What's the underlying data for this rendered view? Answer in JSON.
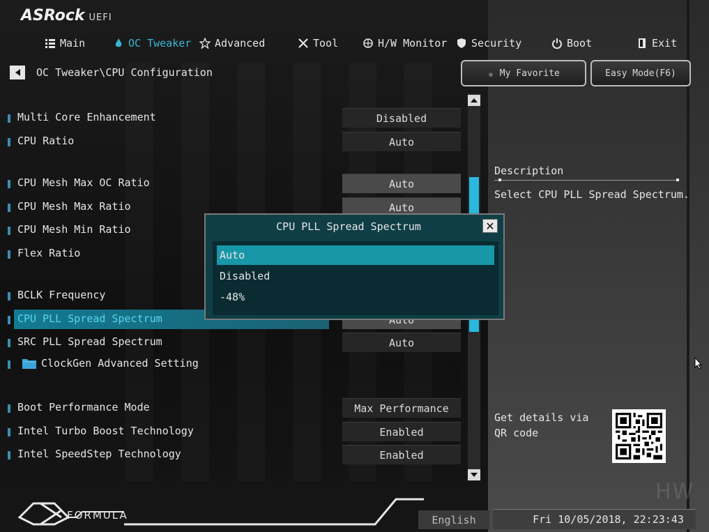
{
  "brand": {
    "name": "ASRock",
    "suffix": "UEFI"
  },
  "nav": [
    {
      "label": "Main",
      "icon": "list-icon",
      "active": false
    },
    {
      "label": "OC Tweaker",
      "icon": "flame-icon",
      "active": true
    },
    {
      "label": "Advanced",
      "icon": "star-icon",
      "active": false
    },
    {
      "label": "Tool",
      "icon": "tools-icon",
      "active": false
    },
    {
      "label": "H/W Monitor",
      "icon": "monitor-icon",
      "active": false
    },
    {
      "label": "Security",
      "icon": "shield-icon",
      "active": false
    },
    {
      "label": "Boot",
      "icon": "power-icon",
      "active": false
    },
    {
      "label": "Exit",
      "icon": "exit-icon",
      "active": false
    }
  ],
  "breadcrumb": "OC Tweaker\\CPU Configuration",
  "buttons": {
    "favorite": "My Favorite",
    "easy_mode": "Easy Mode(F6)"
  },
  "settings": [
    {
      "label": "Multi Core Enhancement",
      "value": "Disabled"
    },
    {
      "label": "CPU Ratio",
      "value": "Auto"
    },
    {
      "label": "CPU Mesh Max OC Ratio",
      "value": "Auto"
    },
    {
      "label": "CPU Mesh Max Ratio",
      "value": "Auto"
    },
    {
      "label": "CPU Mesh Min Ratio",
      "value": ""
    },
    {
      "label": "Flex Ratio",
      "value": ""
    },
    {
      "label": "BCLK Frequency",
      "value": ""
    },
    {
      "label": "CPU PLL Spread Spectrum",
      "value": "Auto",
      "selected": true
    },
    {
      "label": "SRC PLL Spread Spectrum",
      "value": "Auto"
    },
    {
      "label": "ClockGen Advanced Setting",
      "value": ""
    },
    {
      "label": "Boot Performance Mode",
      "value": "Max Performance"
    },
    {
      "label": "Intel Turbo Boost Technology",
      "value": "Enabled"
    },
    {
      "label": "Intel SpeedStep Technology",
      "value": "Enabled"
    }
  ],
  "description": {
    "title": "Description",
    "text": "Select CPU PLL Spread Spectrum.",
    "qr_text": "Get details via QR code"
  },
  "popup": {
    "title": "CPU PLL Spread Spectrum",
    "options": [
      "Auto",
      "Disabled",
      "-48%"
    ],
    "selected_index": 0
  },
  "footer": {
    "brand": "FORMULA",
    "language": "English",
    "datetime": "Fri 10/05/2018, 22:23:43"
  },
  "colors": {
    "accent": "#2ab8dc",
    "highlight": "#137a92",
    "popup_bg": "#0f3e46"
  }
}
